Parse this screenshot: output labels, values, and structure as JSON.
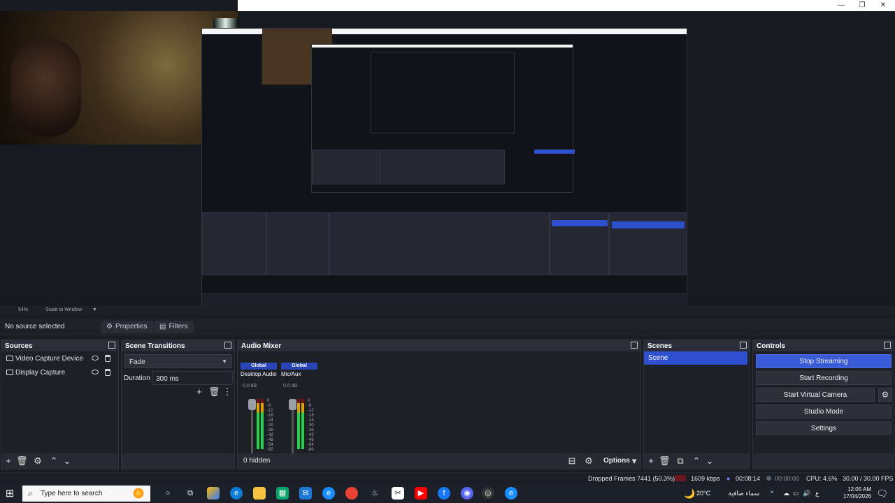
{
  "window": {
    "minimize": "—",
    "maximize": "❐",
    "close": "✕"
  },
  "preview": {
    "zoom_level": "54%",
    "scale_mode": "Scale to Window"
  },
  "context_bar": {
    "no_source": "No source selected",
    "properties_label": "Properties",
    "filters_label": "Filters"
  },
  "sources": {
    "title": "Sources",
    "items": [
      {
        "label": "Video Capture Device",
        "icon": "camera-icon"
      },
      {
        "label": "Display Capture",
        "icon": "monitor-icon"
      }
    ]
  },
  "scene_transitions": {
    "title": "Scene Transitions",
    "transition": "Fade",
    "duration_label": "Duration",
    "duration_value": "300 ms"
  },
  "audio_mixer": {
    "title": "Audio Mixer",
    "channels": [
      {
        "global": "Global",
        "name": "Desktop Audio",
        "db": "0.0 dB",
        "meter_level": 0.82
      },
      {
        "global": "Global",
        "name": "Mic/Aux",
        "db": "0.0 dB",
        "meter_level": 0.86
      }
    ],
    "scale": [
      "0",
      "-6",
      "-12",
      "-18",
      "-24",
      "-30",
      "-36",
      "-42",
      "-48",
      "-54",
      "-60"
    ],
    "hidden": "0 hidden",
    "options_label": "Options"
  },
  "scenes": {
    "title": "Scenes",
    "items": [
      "Scene"
    ]
  },
  "controls": {
    "title": "Controls",
    "buttons": [
      "Stop Streaming",
      "Start Recording",
      "Start Virtual Camera",
      "Studio Mode",
      "Settings"
    ]
  },
  "status": {
    "dropped_frames": "Dropped Frames 7441 (50.3%)",
    "bitrate": "1609 kbps",
    "stream_time": "00:08:14",
    "record_time": "00:00:00",
    "cpu": "CPU: 4.6%",
    "fps": "30.00 / 30.00 FPS"
  },
  "taskbar": {
    "search_placeholder": "Type here to search",
    "weather": "20°C",
    "weather_text": "سماء صافية",
    "language": "ع",
    "time": "12:05 AM",
    "date": "17/04/2026"
  },
  "colors": {
    "accent": "#2f4fd1",
    "panel": "#272a33",
    "meter_green": "#21d24b",
    "meter_yellow": "#e0a000",
    "meter_red": "#7a1010"
  }
}
